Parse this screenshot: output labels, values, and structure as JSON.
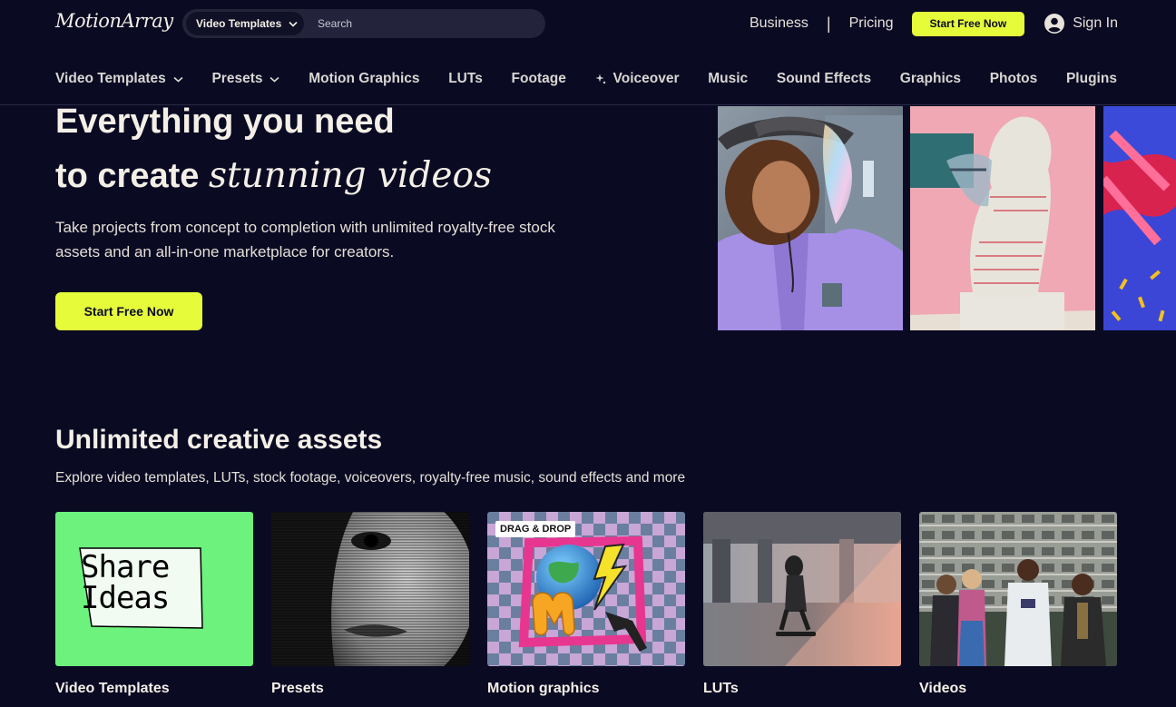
{
  "header": {
    "logo": "MotionArray",
    "search": {
      "category": "Video Templates",
      "placeholder": "Search"
    },
    "links": {
      "business": "Business",
      "separator": "|",
      "pricing": "Pricing"
    },
    "cta": "Start Free Now",
    "signin": "Sign In",
    "accent_color": "#e6fb3a"
  },
  "nav": {
    "items": [
      {
        "label": "Video Templates",
        "dropdown": true
      },
      {
        "label": "Presets",
        "dropdown": true
      },
      {
        "label": "Motion Graphics"
      },
      {
        "label": "LUTs"
      },
      {
        "label": "Footage"
      },
      {
        "label": "Voiceover",
        "icon": "sparkle-icon"
      },
      {
        "label": "Music"
      },
      {
        "label": "Sound Effects"
      },
      {
        "label": "Graphics"
      },
      {
        "label": "Photos"
      },
      {
        "label": "Plugins"
      }
    ]
  },
  "hero": {
    "title_line1": "Everything you need",
    "title_line2_plain": "to create",
    "title_line2_italic": "stunning videos",
    "subtitle": "Take projects from concept to completion with unlimited royalty-free stock assets and an all-in-one marketplace for creators.",
    "cta": "Start Free Now"
  },
  "assets": {
    "title": "Unlimited creative assets",
    "subtitle": "Explore video templates, LUTs, stock footage, voiceovers, royalty-free music, sound effects and more",
    "cards": [
      {
        "label": "Video Templates",
        "thumb_text": "Share Ideas"
      },
      {
        "label": "Presets"
      },
      {
        "label": "Motion graphics",
        "badge": "DRAG & DROP"
      },
      {
        "label": "LUTs"
      },
      {
        "label": "Videos"
      }
    ]
  }
}
